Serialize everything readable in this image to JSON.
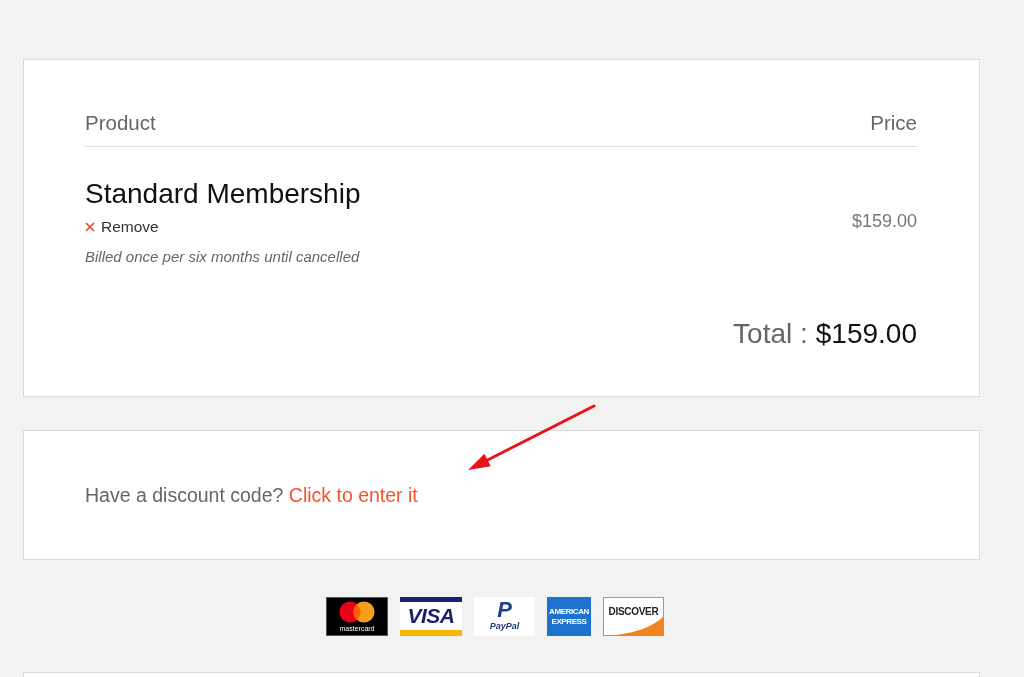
{
  "cart": {
    "columns": [
      {
        "label": "Product"
      },
      {
        "label": "Price"
      }
    ],
    "items": [
      {
        "name": "Standard Membership",
        "remove_label": "Remove",
        "billing_note": "Billed once per six months until cancelled",
        "price": "$159.00"
      }
    ],
    "total": {
      "label": "Total :",
      "value": "$159.00"
    }
  },
  "discount": {
    "prompt": "Have a discount code?",
    "link": "Click to enter it"
  },
  "payment_logos": [
    {
      "kind": "mastercard",
      "text": "mastercard"
    },
    {
      "kind": "visa",
      "text": "VISA"
    },
    {
      "kind": "paypal",
      "mark": "P",
      "text": "PayPal"
    },
    {
      "kind": "amex",
      "text": "AMERICAN EXPRESS"
    },
    {
      "kind": "discover",
      "text": "DISCOVER"
    }
  ]
}
